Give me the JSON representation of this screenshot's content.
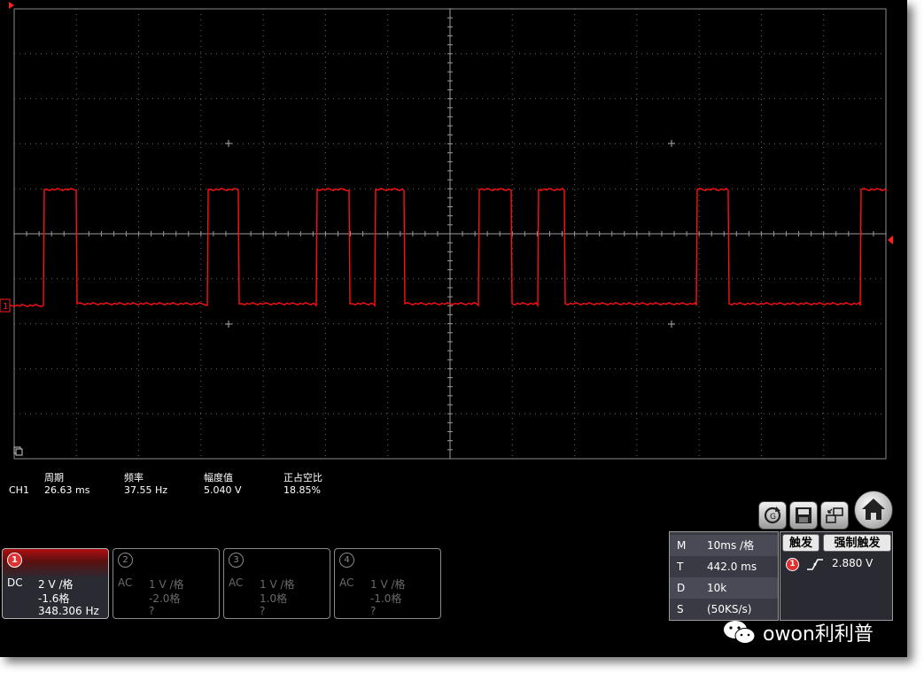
{
  "measurements": {
    "channel": "CH1",
    "items": [
      {
        "label": "周期",
        "value": "26.63 ms"
      },
      {
        "label": "频率",
        "value": "37.55 Hz"
      },
      {
        "label": "幅度值",
        "value": "5.040 V"
      },
      {
        "label": "正占空比",
        "value": "18.85%"
      }
    ]
  },
  "channels": [
    {
      "num": "1",
      "coupling": "DC",
      "scale": "2 V /格",
      "offset": "-1.6格",
      "freq": "348.306 Hz",
      "active": true
    },
    {
      "num": "2",
      "coupling": "AC",
      "scale": "1 V /格",
      "offset": "-2.0格",
      "freq": "?",
      "active": false
    },
    {
      "num": "3",
      "coupling": "AC",
      "scale": "1 V /格",
      "offset": "1.0格",
      "freq": "?",
      "active": false
    },
    {
      "num": "4",
      "coupling": "AC",
      "scale": "1 V /格",
      "offset": "-1.0格",
      "freq": "?",
      "active": false
    }
  ],
  "timebase": {
    "rows": [
      {
        "key": "M",
        "value": "10ms /格"
      },
      {
        "key": "T",
        "value": "442.0 ms"
      },
      {
        "key": "D",
        "value": "10k"
      },
      {
        "key": "S",
        "value": "(50KS/s)"
      }
    ]
  },
  "trigger": {
    "trig_label": "触发",
    "force_label": "强制触发",
    "source": "1",
    "level": "2.880 V"
  },
  "marker": {
    "channel": "1"
  },
  "watermark": {
    "text": "owon利利普"
  },
  "colors": {
    "trace": "#ff1010",
    "grid": "#6a6a6a",
    "axis": "#9a9a9a",
    "active_channel": "#e03030"
  }
}
